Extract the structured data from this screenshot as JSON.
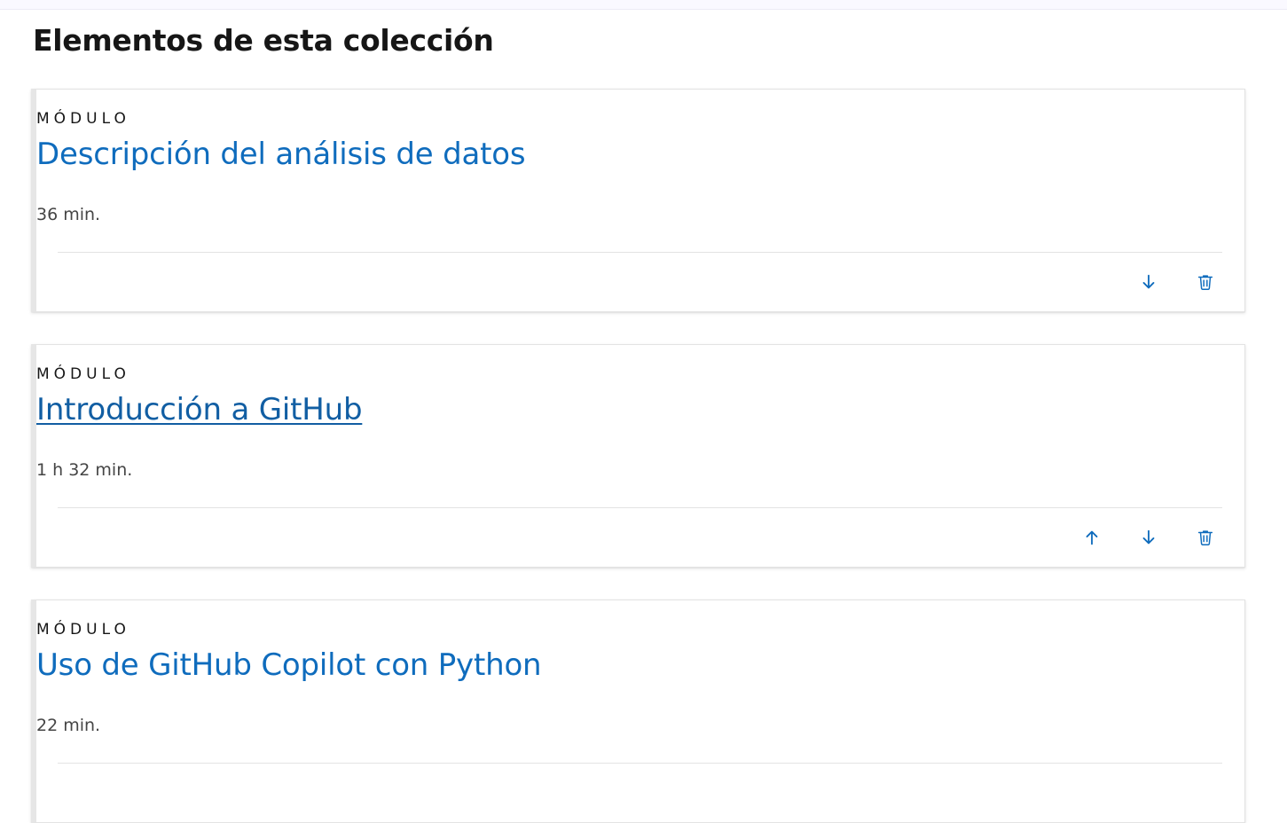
{
  "section": {
    "title": "Elementos de esta colección"
  },
  "cards": [
    {
      "kind": "MÓDULO",
      "title": "Descripción del análisis de datos",
      "duration": "36 min.",
      "actions": [
        "move-down",
        "delete"
      ]
    },
    {
      "kind": "MÓDULO",
      "title": "Introducción a GitHub",
      "duration": "1 h 32 min.",
      "actions": [
        "move-up",
        "move-down",
        "delete"
      ]
    },
    {
      "kind": "MÓDULO",
      "title": "Uso de GitHub Copilot con Python",
      "duration": "22 min.",
      "actions": []
    }
  ],
  "colors": {
    "link": "#0f6cbd",
    "text": "#161616",
    "muted": "#454545"
  }
}
